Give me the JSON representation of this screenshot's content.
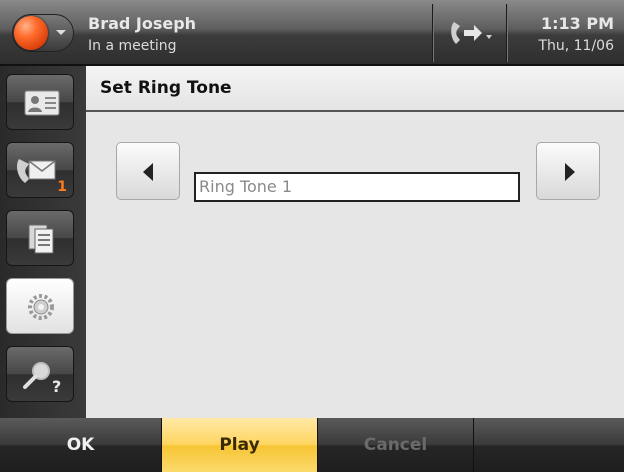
{
  "status_bar": {
    "user_name": "Brad Joseph",
    "presence_status": "In a meeting",
    "presence_color": "#ff6a2a",
    "call_forward_icon": "call-forward-icon",
    "time": "1:13 PM",
    "date": "Thu, 11/06"
  },
  "sidebar": {
    "items": [
      {
        "icon": "contact-card-icon"
      },
      {
        "icon": "phone-voicemail-icon",
        "badge": "1"
      },
      {
        "icon": "documents-icon"
      },
      {
        "icon": "settings-gear-icon",
        "active": true
      },
      {
        "icon": "search-help-icon"
      }
    ],
    "badge_color": "#ff7a1a"
  },
  "main": {
    "title": "Set Ring Tone",
    "ringtone_value": "Ring Tone 1",
    "prev_icon": "left-arrow-icon",
    "next_icon": "right-arrow-icon"
  },
  "softkeys": {
    "ok_label": "OK",
    "play_label": "Play",
    "cancel_label": "Cancel",
    "accent_color": "#ffd560"
  }
}
